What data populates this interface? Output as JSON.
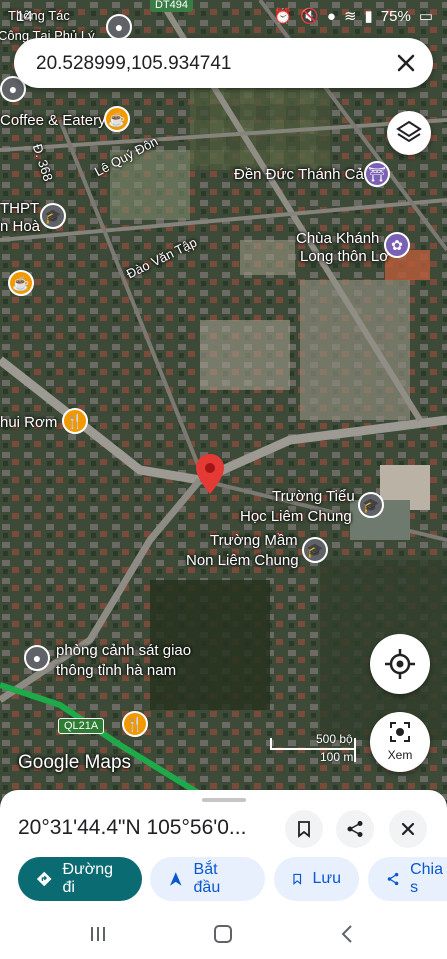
{
  "status": {
    "time": "14",
    "battery": "75%"
  },
  "search": {
    "value": "20.528999,105.934741"
  },
  "map_labels": {
    "top_left_1": "Thông Tác",
    "top_left_2": "Công Tại Phủ Lý",
    "road_dt494": "DT494",
    "coffee": "Coffee & Eatery",
    "d368": "Đ. 368",
    "le_quy_don": "Lê Quý Đôn",
    "den": "Đền Đức Thánh Cả",
    "thpt_1": "THPT",
    "thpt_2": "n Hoà",
    "chua_1": "Chùa Khánh",
    "chua_2": "Long thôn Lơ",
    "dao_van_tap": "Đào Văn Tập",
    "rom": "hui Rơm",
    "tieu_hoc_1": "Trường Tiểu",
    "tieu_hoc_2": "Học Liêm Chung",
    "mam_non_1": "Trường Mầm",
    "mam_non_2": "Non Liêm Chung",
    "csgt_1": "phòng cảnh sát giao",
    "csgt_2": "thông tỉnh hà nam",
    "ql21a": "QL21A",
    "google_maps": "Google Maps",
    "scale_ft": "500 bộ",
    "scale_m": "100 m"
  },
  "buttons": {
    "xem": "Xem"
  },
  "sheet": {
    "coords": "20°31'44.4\"N 105°56'0...",
    "chips": [
      {
        "label": "Đường đi"
      },
      {
        "label": "Bắt đầu"
      },
      {
        "label": "Lưu"
      },
      {
        "label": "Chia s"
      }
    ]
  },
  "colors": {
    "primary_chip": "#0b6b73",
    "chip_bg": "#e8f0fe",
    "chip_text": "#0b57d0",
    "pin": "#e53935"
  }
}
